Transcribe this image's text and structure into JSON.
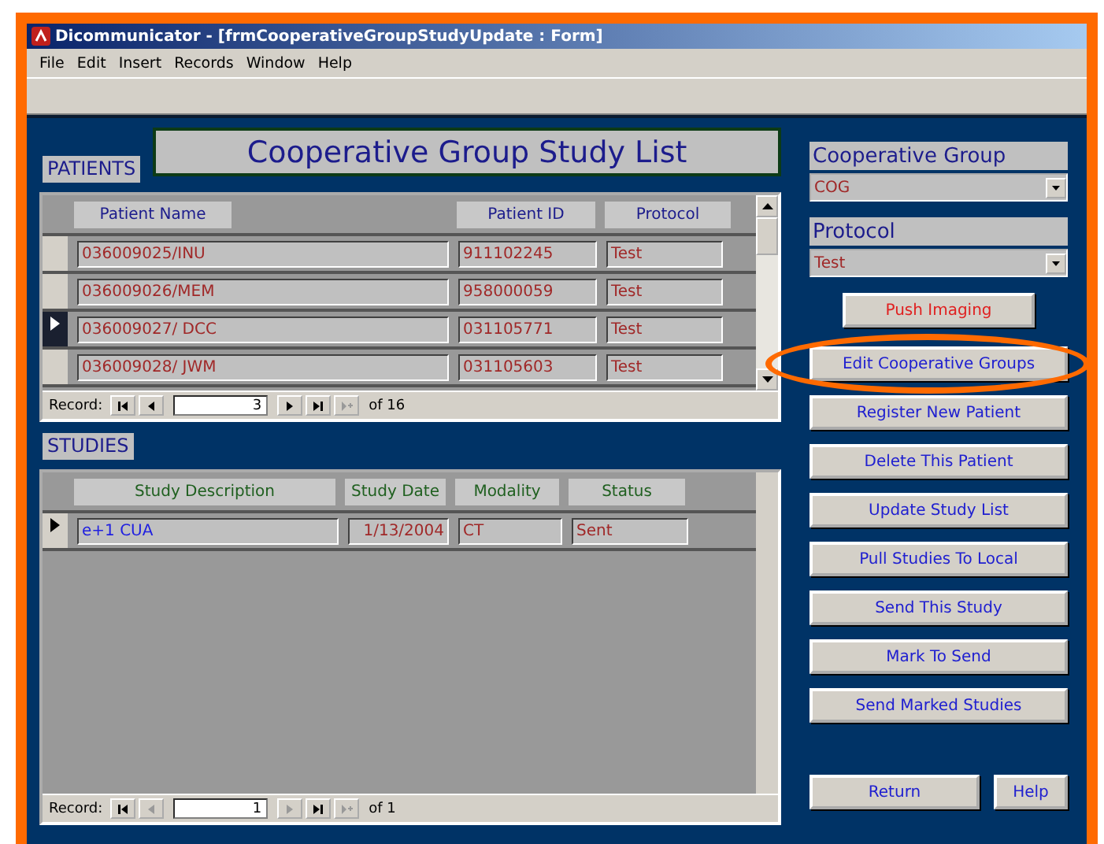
{
  "window": {
    "title": "Dicommunicator - [frmCooperativeGroupStudyUpdate : Form]"
  },
  "menu": [
    "File",
    "Edit",
    "Insert",
    "Records",
    "Window",
    "Help"
  ],
  "form_title": "Cooperative Group Study List",
  "patients": {
    "label": "PATIENTS",
    "columns": [
      {
        "label": "Patient Name",
        "color": "#a02828"
      },
      {
        "label": "Patient ID",
        "color": "#a02828"
      },
      {
        "label": "Protocol",
        "color": "#a02828"
      }
    ],
    "rows": [
      {
        "cells": [
          "036009025/INU",
          "911102245",
          "Test"
        ],
        "selected": false
      },
      {
        "cells": [
          "036009026/MEM",
          "958000059",
          "Test"
        ],
        "selected": false
      },
      {
        "cells": [
          "036009027/ DCC",
          "031105771",
          "Test"
        ],
        "selected": true
      },
      {
        "cells": [
          "036009028/ JWM",
          "031105603",
          "Test"
        ],
        "selected": false
      }
    ],
    "nav": {
      "label": "Record:",
      "value": "3",
      "total": "of 16",
      "buttons": [
        {
          "kind": "first",
          "disabled": false
        },
        {
          "kind": "prev",
          "disabled": false
        },
        {
          "kind": "next",
          "disabled": false
        },
        {
          "kind": "last",
          "disabled": false
        },
        {
          "kind": "new",
          "disabled": true
        }
      ]
    }
  },
  "studies": {
    "label": "STUDIES",
    "columns": [
      {
        "label": "Study Description",
        "color": "#2020e0"
      },
      {
        "label": "Study Date",
        "color": "#a02828"
      },
      {
        "label": "Modality",
        "color": "#a02828"
      },
      {
        "label": "Status",
        "color": "#a02828"
      }
    ],
    "rows": [
      {
        "cells": [
          "e+1 CUA",
          "1/13/2004",
          "CT",
          "Sent"
        ],
        "selected": true
      }
    ],
    "nav": {
      "label": "Record:",
      "value": "1",
      "total": "of 1",
      "buttons": [
        {
          "kind": "first",
          "disabled": false
        },
        {
          "kind": "prev",
          "disabled": true
        },
        {
          "kind": "next",
          "disabled": true
        },
        {
          "kind": "last",
          "disabled": false
        },
        {
          "kind": "new",
          "disabled": true
        }
      ]
    }
  },
  "filters": [
    {
      "label": "Cooperative Group",
      "value": "COG"
    },
    {
      "label": "Protocol",
      "value": "Test"
    }
  ],
  "buttons": [
    {
      "label": "Push Imaging",
      "kind": "alert",
      "highlighted": false
    },
    {
      "label": "Edit Cooperative Groups",
      "kind": "action",
      "highlighted": true
    },
    {
      "label": "Register New Patient",
      "kind": "action",
      "highlighted": false
    },
    {
      "label": "Delete This Patient",
      "kind": "action",
      "highlighted": false
    },
    {
      "label": "Update Study List",
      "kind": "action",
      "highlighted": false
    },
    {
      "label": "Pull Studies To Local",
      "kind": "action",
      "highlighted": false
    },
    {
      "label": "Send This Study",
      "kind": "action",
      "highlighted": false
    },
    {
      "label": "Mark To Send",
      "kind": "action",
      "highlighted": false
    },
    {
      "label": "Send Marked Studies",
      "kind": "action",
      "highlighted": false
    }
  ],
  "footer_buttons": [
    "Return",
    "Help"
  ]
}
